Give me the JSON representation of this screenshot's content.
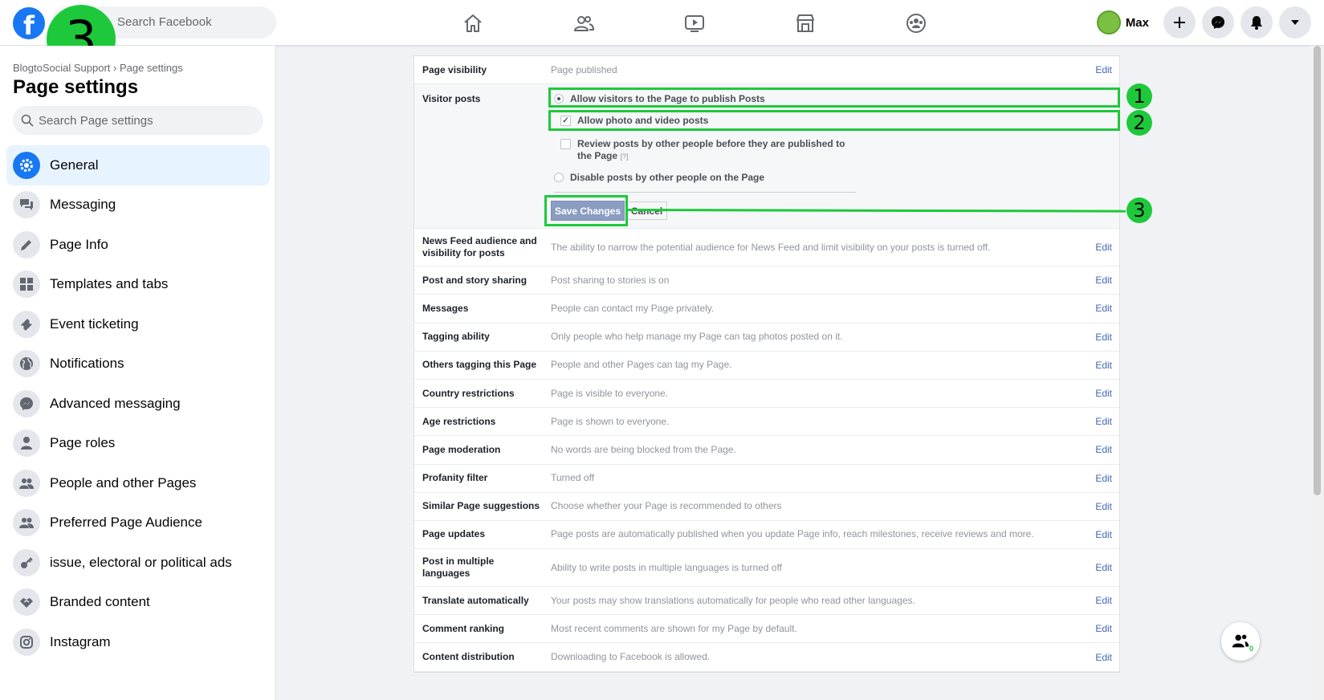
{
  "top": {
    "logo": "f",
    "search_placeholder": "Search Facebook",
    "user_name": "Max"
  },
  "step_badge": "3",
  "sidebar": {
    "breadcrumb": "BlogtoSocial Support › Page settings",
    "title": "Page settings",
    "search_placeholder": "Search Page settings",
    "items": [
      {
        "label": "General",
        "icon": "gear-icon"
      },
      {
        "label": "Messaging",
        "icon": "chat-icon"
      },
      {
        "label": "Page Info",
        "icon": "pencil-icon"
      },
      {
        "label": "Templates and tabs",
        "icon": "grid-icon"
      },
      {
        "label": "Event ticketing",
        "icon": "ticket-icon"
      },
      {
        "label": "Notifications",
        "icon": "globe-icon"
      },
      {
        "label": "Advanced messaging",
        "icon": "messenger-icon"
      },
      {
        "label": "Page roles",
        "icon": "person-icon"
      },
      {
        "label": "People and other Pages",
        "icon": "people-icon"
      },
      {
        "label": "Preferred Page Audience",
        "icon": "people-icon"
      },
      {
        "label": "issue, electoral or political ads",
        "icon": "key-icon"
      },
      {
        "label": "Branded content",
        "icon": "handshake-icon"
      },
      {
        "label": "Instagram",
        "icon": "instagram-icon"
      }
    ]
  },
  "settings": {
    "edit_label": "Edit",
    "page_visibility": {
      "label": "Page visibility",
      "value": "Page published"
    },
    "visitor_posts": {
      "label": "Visitor posts",
      "opt_allow": "Allow visitors to the Page to publish Posts",
      "opt_photo": "Allow photo and video posts",
      "opt_review": "Review posts by other people before they are published to the Page",
      "help": "[?]",
      "opt_disable": "Disable posts by other people on the Page",
      "save": "Save Changes",
      "cancel": "Cancel"
    },
    "rows": [
      {
        "label": "News Feed audience and visibility for posts",
        "value": "The ability to narrow the potential audience for News Feed and limit visibility on your posts is turned off."
      },
      {
        "label": "Post and story sharing",
        "value": "Post sharing to stories is on"
      },
      {
        "label": "Messages",
        "value": "People can contact my Page privately."
      },
      {
        "label": "Tagging ability",
        "value": "Only people who help manage my Page can tag photos posted on it."
      },
      {
        "label": "Others tagging this Page",
        "value": "People and other Pages can tag my Page."
      },
      {
        "label": "Country restrictions",
        "value": "Page is visible to everyone."
      },
      {
        "label": "Age restrictions",
        "value": "Page is shown to everyone."
      },
      {
        "label": "Page moderation",
        "value": "No words are being blocked from the Page."
      },
      {
        "label": "Profanity filter",
        "value": "Turned off"
      },
      {
        "label": "Similar Page suggestions",
        "value": "Choose whether your Page is recommended to others"
      },
      {
        "label": "Page updates",
        "value": "Page posts are automatically published when you update Page info, reach milestones, receive reviews and more."
      },
      {
        "label": "Post in multiple languages",
        "value": "Ability to write posts in multiple languages is turned off"
      },
      {
        "label": "Translate automatically",
        "value": "Your posts may show translations automatically for people who read other languages."
      },
      {
        "label": "Comment ranking",
        "value": "Most recent comments are shown for my Page by default."
      },
      {
        "label": "Content distribution",
        "value": "Downloading to Facebook is allowed."
      }
    ]
  },
  "annotations": {
    "n1": "1",
    "n2": "2",
    "n3": "3"
  },
  "float_badge": "0",
  "colors": {
    "brand": "#1877f2",
    "highlight": "#1dc93a",
    "link": "#4267b2"
  }
}
